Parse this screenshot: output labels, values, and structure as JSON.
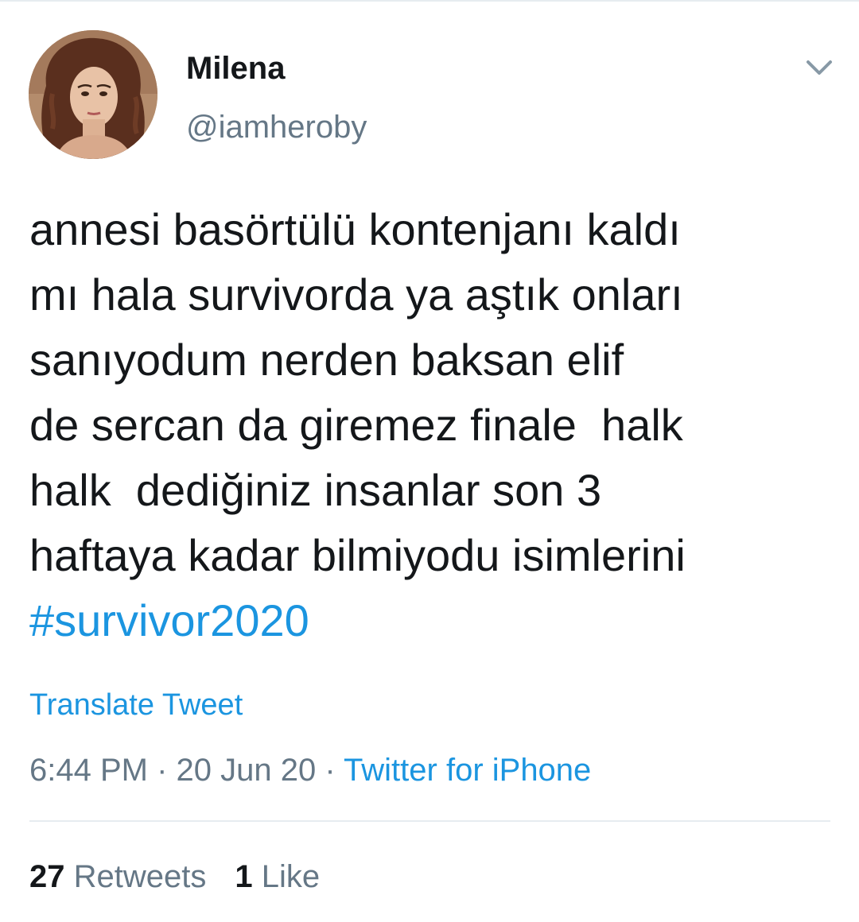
{
  "user": {
    "display_name": "Milena",
    "handle": "@iamheroby",
    "avatar_icon": "profile-photo"
  },
  "tweet": {
    "lines": [
      "annesi basörtülü kontenjanı kaldı",
      "mı hala survivorda ya aştık onları",
      "sanıyodum nerden baksan elif",
      "de sercan da giremez finale  halk",
      "halk  dediğiniz insanlar son 3",
      "haftaya kadar bilmiyodu isimlerini"
    ],
    "hashtag": "#survivor2020",
    "translate_label": "Translate Tweet"
  },
  "meta": {
    "time": "6:44 PM",
    "separator1": " · ",
    "date": "20 Jun 20",
    "separator2": " · ",
    "source": "Twitter for iPhone"
  },
  "stats": {
    "retweets_count": "27",
    "retweets_label": "Retweets",
    "likes_count": "1",
    "likes_label": "Like"
  },
  "colors": {
    "link": "#1b95e0",
    "text": "#14171a",
    "secondary": "#657786",
    "divider": "#e6ecf0"
  }
}
